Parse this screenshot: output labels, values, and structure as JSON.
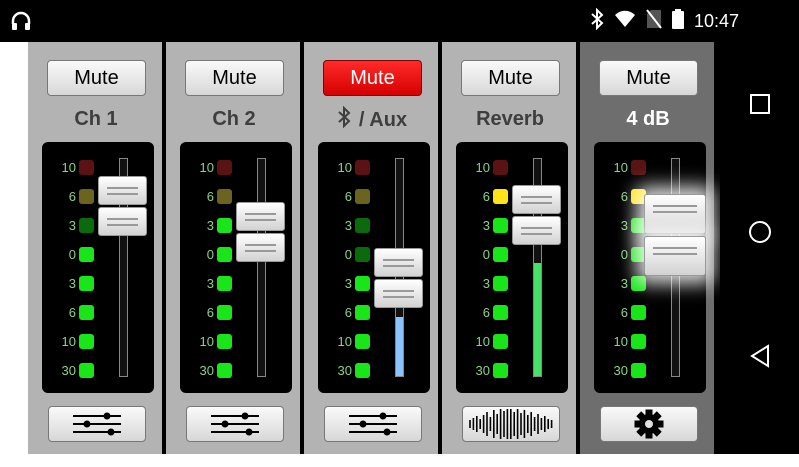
{
  "status_bar": {
    "time": "10:47",
    "icons": [
      "headphones-icon",
      "bluetooth-icon",
      "wifi-icon",
      "no-sim-icon",
      "battery-icon"
    ]
  },
  "nav_bar": {
    "buttons": [
      "recents-square-icon",
      "home-circle-icon",
      "back-triangle-icon"
    ]
  },
  "colors": {
    "led_green": "#19e619",
    "led_green_dim": "#0b6a0b",
    "led_yellow": "#ffe21a",
    "led_yellow_dim": "#6b6420",
    "led_red_dim": "#5a1212",
    "mute_on": "#ff1a1a",
    "fill_blue": "#8bc3ff",
    "fill_green": "#49e06a"
  },
  "meter_scale": [
    "10",
    "6",
    "3",
    "0",
    "3",
    "6",
    "10",
    "30"
  ],
  "strips": [
    {
      "id": "ch1",
      "mute_label": "Mute",
      "mute_on": false,
      "label": "Ch 1",
      "leds": [
        "red_dim",
        "yellow_dim",
        "green_dim",
        "green",
        "green",
        "green",
        "green",
        "green"
      ],
      "fader_level": 0.78,
      "fill_color": "",
      "fill_level": 0,
      "bottom_icon": "eq-sliders-icon",
      "active": false
    },
    {
      "id": "ch2",
      "mute_label": "Mute",
      "mute_on": false,
      "label": "Ch 2",
      "leds": [
        "red_dim",
        "yellow_dim",
        "green",
        "green",
        "green",
        "green",
        "green",
        "green"
      ],
      "fader_level": 0.66,
      "fill_color": "",
      "fill_level": 0,
      "bottom_icon": "eq-sliders-icon",
      "active": false
    },
    {
      "id": "aux",
      "mute_label": "Mute",
      "mute_on": true,
      "label": "/ Aux",
      "label_icon": "bluetooth-icon",
      "leds": [
        "red_dim",
        "yellow_dim",
        "green_dim",
        "green_dim",
        "green",
        "green",
        "green",
        "green"
      ],
      "fader_level": 0.45,
      "fill_color": "fill_blue",
      "fill_level": 0.27,
      "bottom_icon": "eq-sliders-icon",
      "active": false
    },
    {
      "id": "reverb",
      "mute_label": "Mute",
      "mute_on": false,
      "label": "Reverb",
      "leds": [
        "red_dim",
        "yellow",
        "green",
        "green",
        "green",
        "green",
        "green",
        "green"
      ],
      "fader_level": 0.74,
      "fill_color": "fill_green",
      "fill_level": 0.52,
      "bottom_icon": "waveform-icon",
      "active": false
    },
    {
      "id": "main",
      "mute_label": "Mute",
      "mute_on": false,
      "label": "4  dB",
      "leds": [
        "red_dim",
        "yellow",
        "green",
        "green",
        "green",
        "green",
        "green",
        "green"
      ],
      "fader_level": 0.65,
      "fill_color": "",
      "fill_level": 0,
      "bottom_icon": "gear-icon",
      "active": true
    }
  ]
}
